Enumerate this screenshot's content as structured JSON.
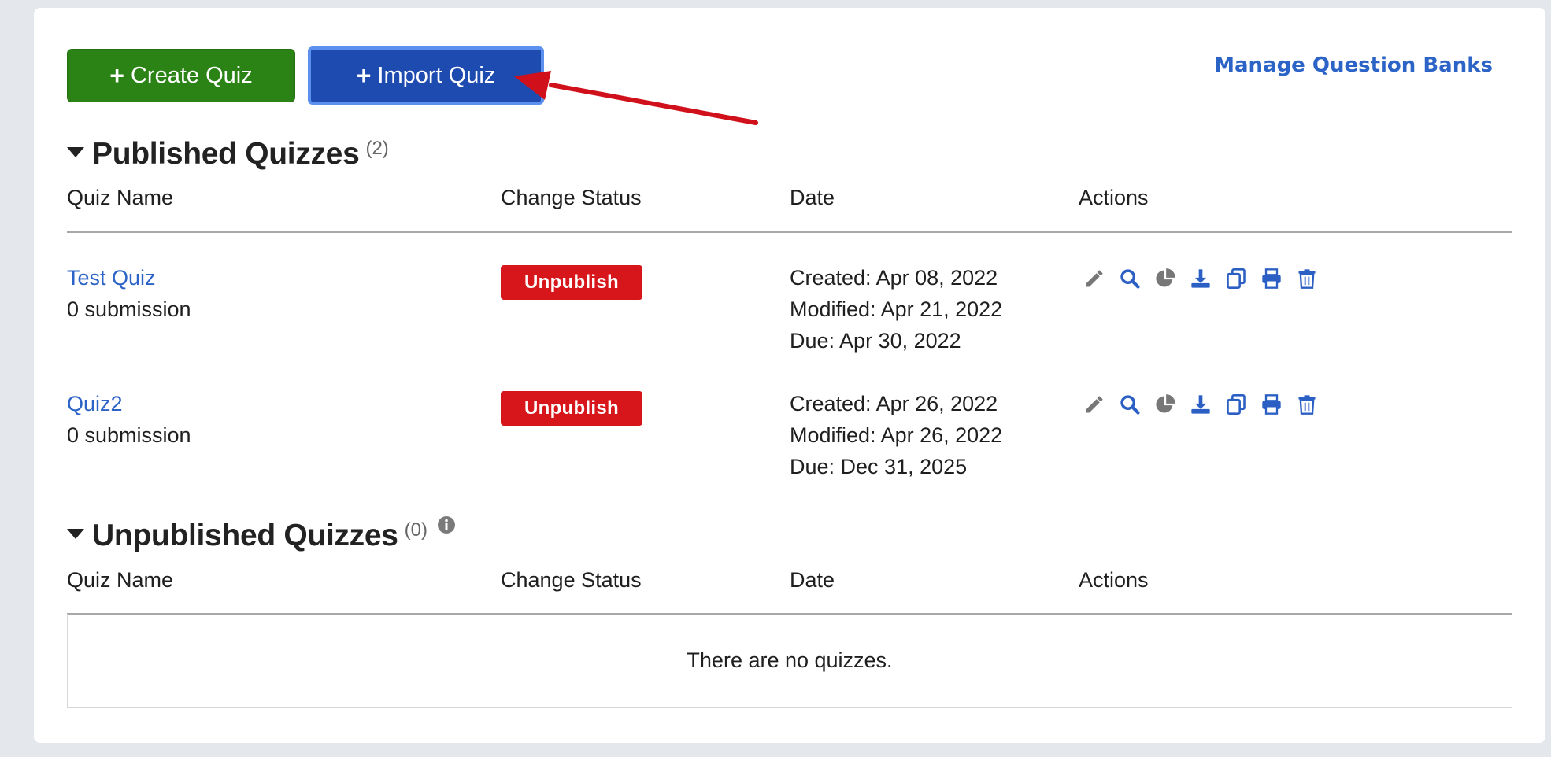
{
  "toolbar": {
    "create_label": "Create Quiz",
    "import_label": "Import Quiz",
    "manage_link": "Manage Question Banks"
  },
  "published": {
    "title": "Published Quizzes",
    "count": "(2)",
    "columns": [
      "Quiz Name",
      "Change Status",
      "Date",
      "Actions"
    ],
    "rows": [
      {
        "name": "Test Quiz",
        "submissions": "0 submission",
        "status_button": "Unpublish",
        "created": "Created: Apr 08, 2022",
        "modified": "Modified: Apr 21, 2022",
        "due": "Due: Apr 30, 2022"
      },
      {
        "name": "Quiz2",
        "submissions": "0 submission",
        "status_button": "Unpublish",
        "created": "Created: Apr 26, 2022",
        "modified": "Modified: Apr 26, 2022",
        "due": "Due: Dec 31, 2025"
      }
    ],
    "action_icons": [
      "edit-icon",
      "search-icon",
      "pie-chart-icon",
      "download-icon",
      "copy-icon",
      "print-icon",
      "trash-icon"
    ]
  },
  "unpublished": {
    "title": "Unpublished Quizzes",
    "count": "(0)",
    "columns": [
      "Quiz Name",
      "Change Status",
      "Date",
      "Actions"
    ],
    "empty_message": "There are no quizzes."
  },
  "colors": {
    "create_button": "#2a8314",
    "import_button": "#1e4bb0",
    "link": "#2b63c6",
    "unpublish_button": "#d6161b",
    "arrow": "#d0111b"
  }
}
